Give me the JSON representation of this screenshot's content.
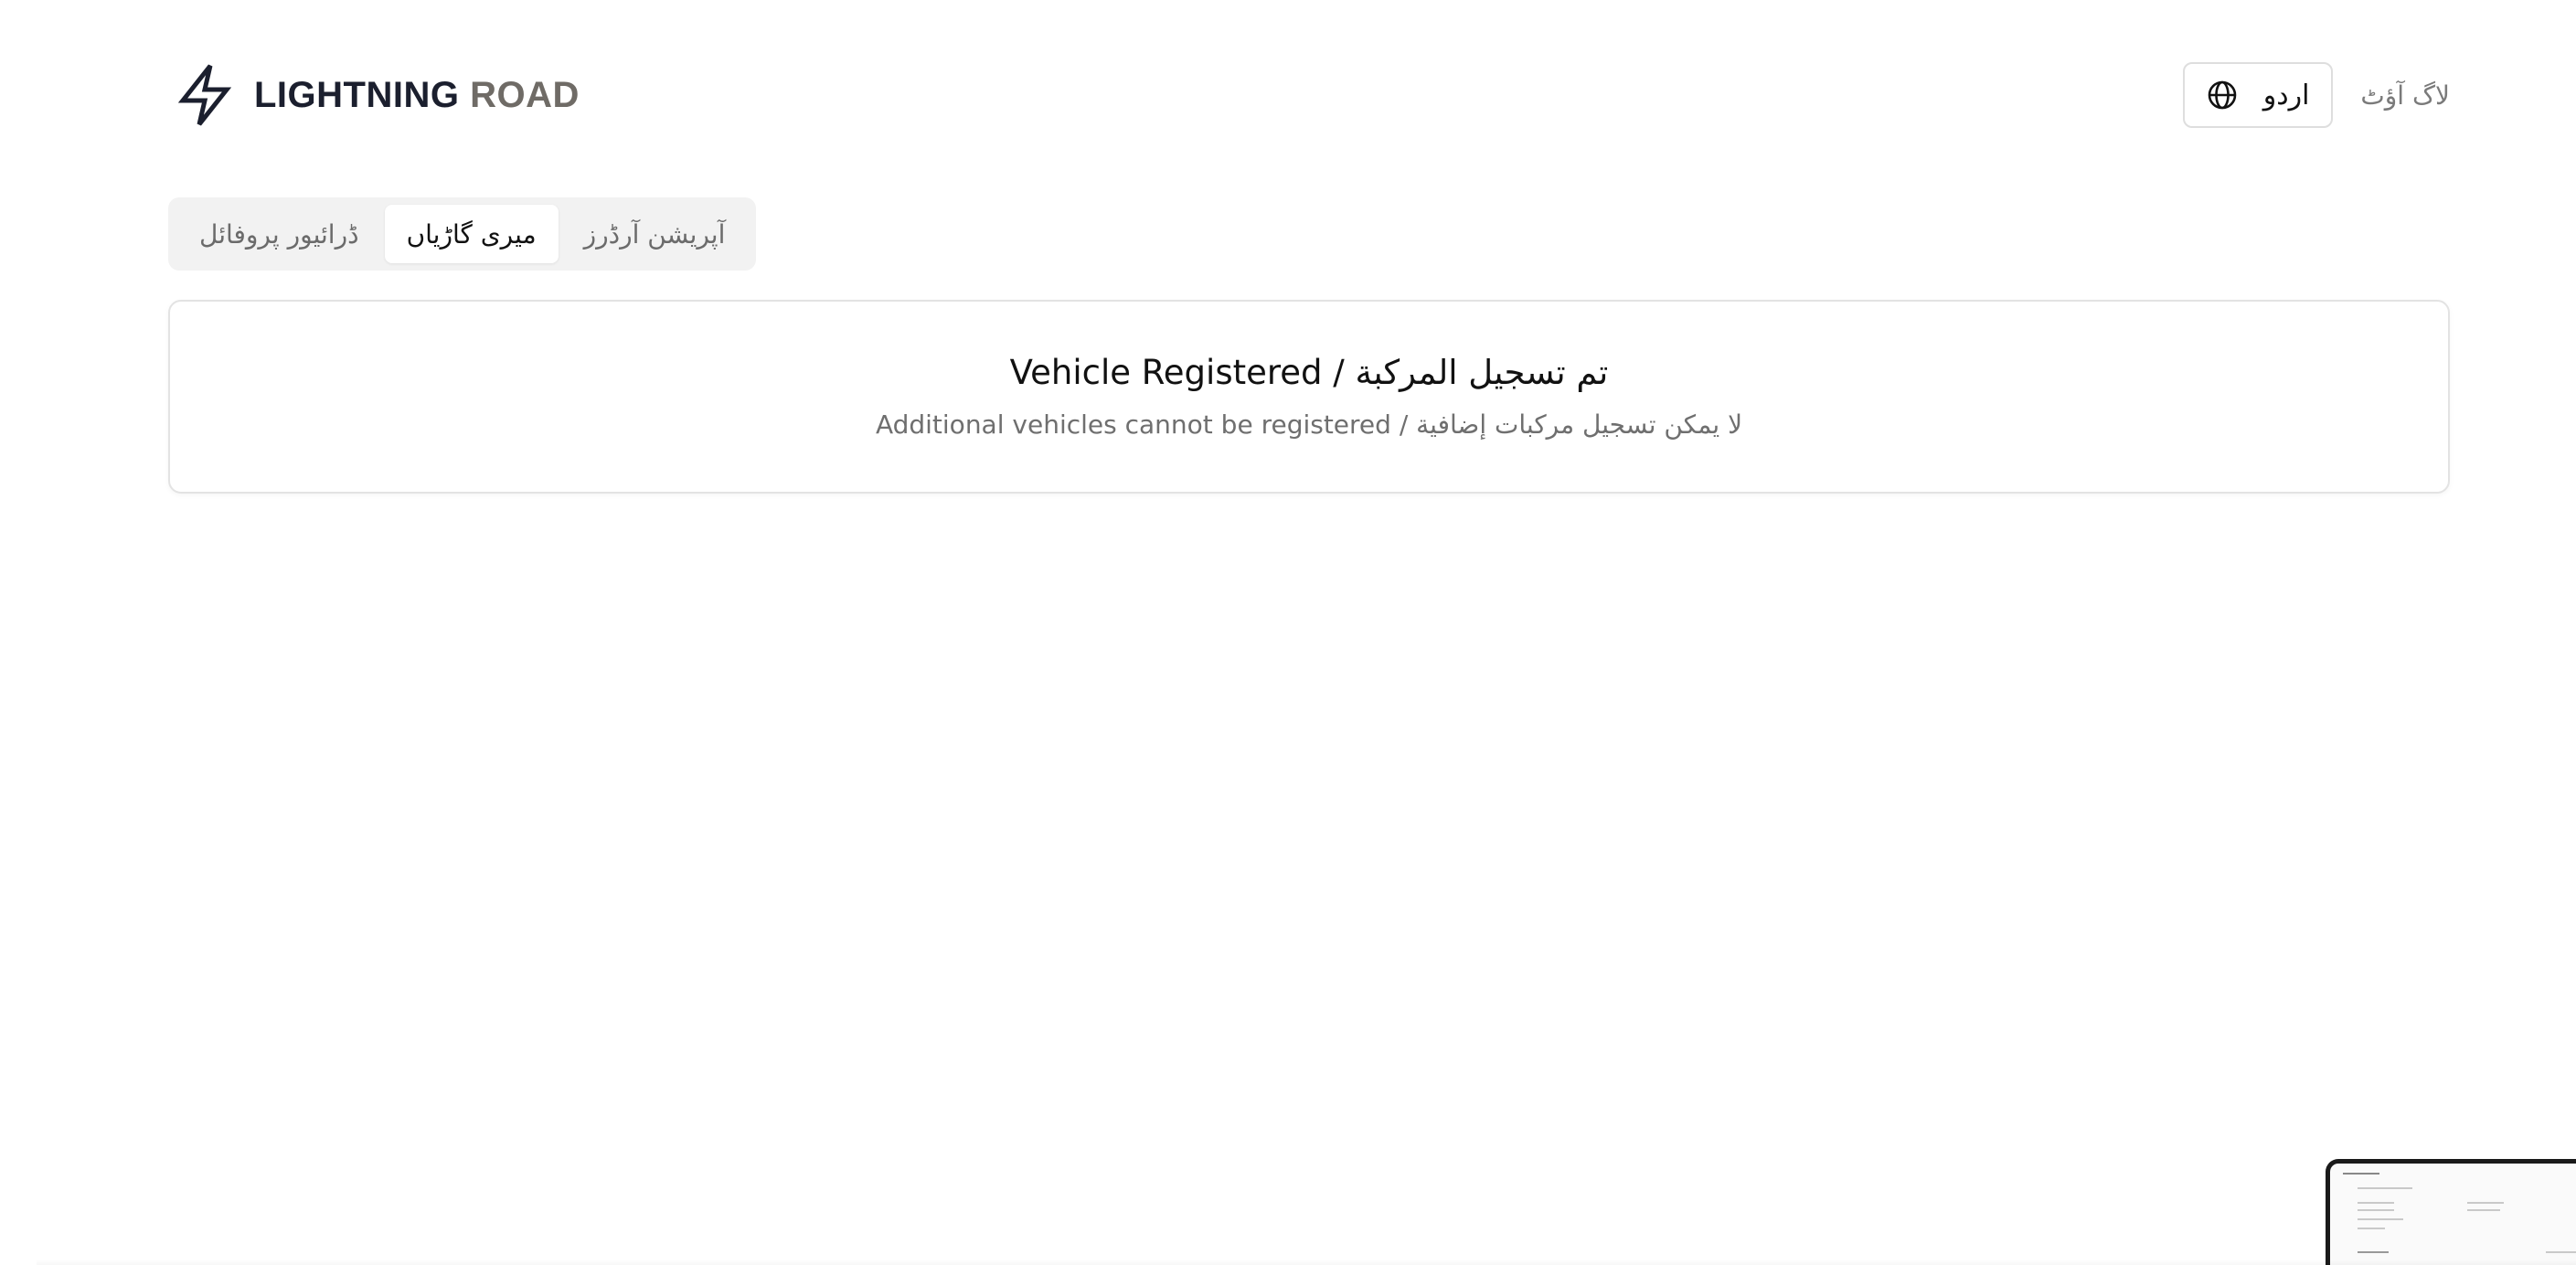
{
  "header": {
    "brand_part1": "LIGHTNING",
    "brand_part2": "ROAD",
    "brand_icon": "lightning-bolt-icon",
    "language_label": "اردو",
    "language_icon": "globe-icon",
    "logout_label": "لاگ آؤٹ"
  },
  "tabs": [
    {
      "label": "آپریشن آرڈرز",
      "active": false
    },
    {
      "label": "میری گاڑیاں",
      "active": true
    },
    {
      "label": "ڈرائیور پروفائل",
      "active": false
    }
  ],
  "card": {
    "title": "Vehicle Registered / تم تسجيل المركبة",
    "subtitle": "Additional vehicles cannot be registered / لا يمكن تسجيل مركبات إضافية"
  },
  "colors": {
    "brand_dark": "#1b1f2e",
    "brand_muted": "#6f6b66",
    "tab_bg": "#f2f2f2",
    "border": "#e3e3e3"
  }
}
